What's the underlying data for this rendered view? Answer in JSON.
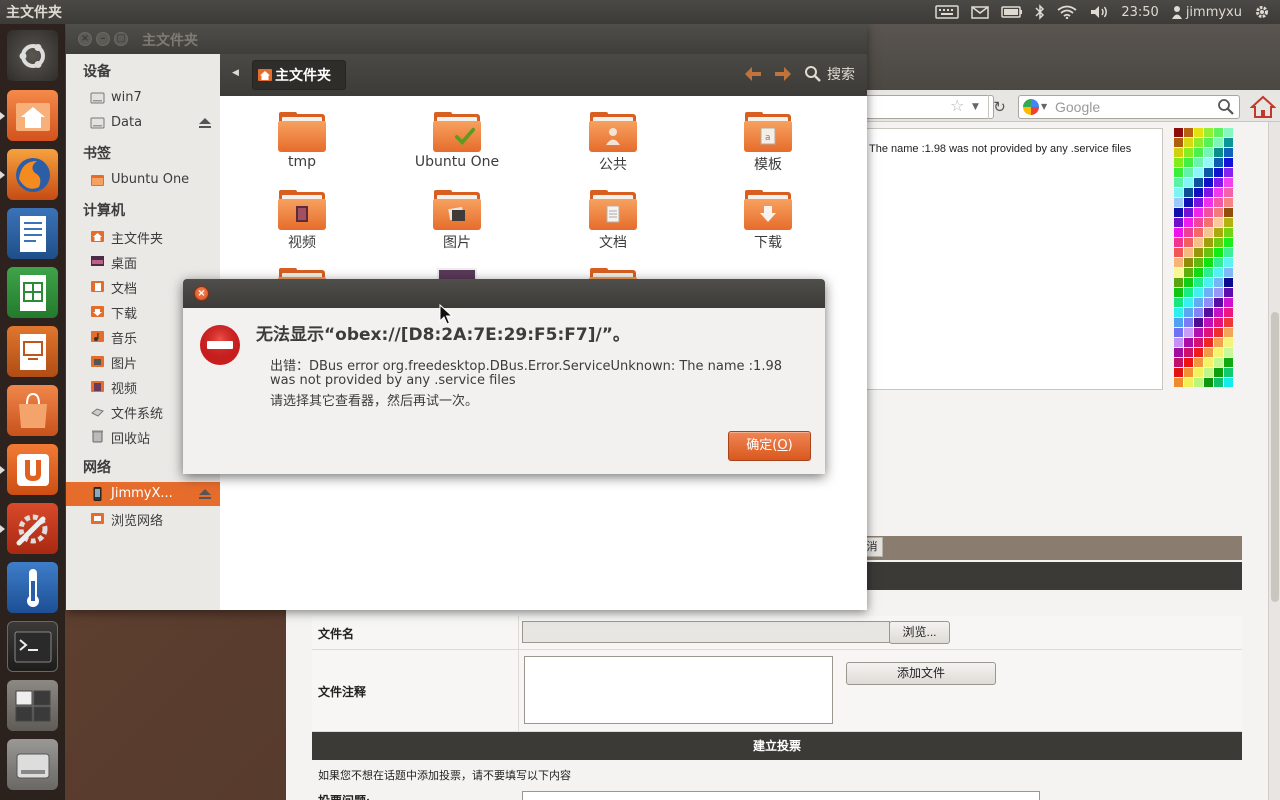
{
  "top_panel": {
    "app_title": "主文件夹",
    "clock": "23:50",
    "user": "jimmyxu"
  },
  "nautilus": {
    "window_title": "主文件夹",
    "breadcrumb": "主文件夹",
    "search_label": "搜索",
    "sidebar": {
      "devices_heading": "设备",
      "devices": [
        {
          "label": "win7",
          "icon": "drive-icon"
        },
        {
          "label": "Data",
          "icon": "drive-icon",
          "eject": true
        }
      ],
      "bookmarks_heading": "书签",
      "bookmarks": [
        {
          "label": "Ubuntu One",
          "icon": "folder-icon"
        }
      ],
      "computer_heading": "计算机",
      "computer": [
        {
          "label": "主文件夹",
          "icon": "home-folder-icon"
        },
        {
          "label": "桌面",
          "icon": "desktop-icon"
        },
        {
          "label": "文档",
          "icon": "documents-folder-icon"
        },
        {
          "label": "下载",
          "icon": "downloads-folder-icon"
        },
        {
          "label": "音乐",
          "icon": "music-folder-icon"
        },
        {
          "label": "图片",
          "icon": "pictures-folder-icon"
        },
        {
          "label": "视频",
          "icon": "videos-folder-icon"
        },
        {
          "label": "文件系统",
          "icon": "filesystem-icon"
        },
        {
          "label": "回收站",
          "icon": "trash-icon"
        }
      ],
      "network_heading": "网络",
      "network": [
        {
          "label": "JimmyX...",
          "icon": "phone-icon",
          "selected": true,
          "eject": true
        },
        {
          "label": "浏览网络",
          "icon": "network-icon"
        }
      ]
    },
    "files": [
      {
        "label": "tmp",
        "emblem": "none"
      },
      {
        "label": "Ubuntu One",
        "emblem": "checkmark"
      },
      {
        "label": "公共",
        "emblem": "person"
      },
      {
        "label": "模板",
        "emblem": "template"
      },
      {
        "label": "视频",
        "emblem": "film"
      },
      {
        "label": "图片",
        "emblem": "photo"
      },
      {
        "label": "文档",
        "emblem": "document"
      },
      {
        "label": "下载",
        "emblem": "download"
      }
    ]
  },
  "dialog": {
    "heading": "无法显示“obex://[D8:2A:7E:29:F5:F7]/”。",
    "body_line1": "出错：DBus error org.freedesktop.DBus.Error.ServiceUnknown: The name :1.98",
    "body_line2": "was not provided by any .service files",
    "body_line3": "请选择其它查看器，然后再试一次。",
    "ok_label": "确定(",
    "ok_mnemonic": "O",
    "ok_suffix": ")"
  },
  "firefox": {
    "search_placeholder": "Google",
    "message": "The name :1.98 was not provided by any .service files",
    "cancel_fragment": "消",
    "file_name_label": "文件名",
    "browse_button": "浏览...",
    "file_note_label": "文件注释",
    "add_file_button": "添加文件",
    "vote_header": "建立投票",
    "vote_hint": "如果您不想在话题中添加投票，请不要填写以下内容",
    "vote_question_label": "投票问题:"
  },
  "colors": {
    "accent": "#e66c2c",
    "panel": "#3c3b37",
    "dialog_ok": "#dd6225"
  }
}
